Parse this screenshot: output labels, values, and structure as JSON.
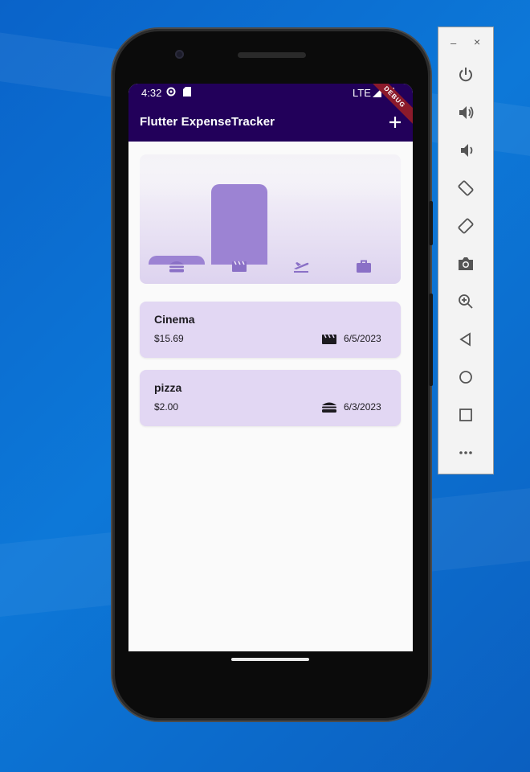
{
  "status_bar": {
    "time": "4:32",
    "network": "LTE",
    "icons": [
      "settings-icon",
      "sd-card-icon",
      "signal-icon",
      "battery-icon"
    ]
  },
  "app": {
    "title": "Flutter ExpenseTracker",
    "add_icon": "plus-icon",
    "debug_banner": "DEBUG",
    "colors": {
      "appbar": "#22005a",
      "bar": "#9c83d3",
      "card": "#e2d7f3"
    }
  },
  "chart": {
    "categories": [
      {
        "name": "food",
        "icon": "hamburger-icon",
        "fill_fraction": 0.11
      },
      {
        "name": "leisure",
        "icon": "movie-clapper-icon",
        "fill_fraction": 1.0
      },
      {
        "name": "travel",
        "icon": "flight-takeoff-icon",
        "fill_fraction": 0
      },
      {
        "name": "work",
        "icon": "briefcase-icon",
        "fill_fraction": 0
      }
    ]
  },
  "expenses": [
    {
      "title": "Cinema",
      "amount": "$15.69",
      "date": "6/5/2023",
      "icon": "movie-clapper-icon"
    },
    {
      "title": "pizza",
      "amount": "$2.00",
      "date": "6/3/2023",
      "icon": "hamburger-icon"
    }
  ],
  "emulator_panel": {
    "minimize": "–",
    "close": "×",
    "buttons": [
      "power-icon",
      "volume-up-icon",
      "volume-down-icon",
      "rotate-left-icon",
      "rotate-right-icon",
      "camera-icon",
      "zoom-icon",
      "back-icon",
      "home-icon",
      "overview-icon",
      "more-icon"
    ]
  }
}
